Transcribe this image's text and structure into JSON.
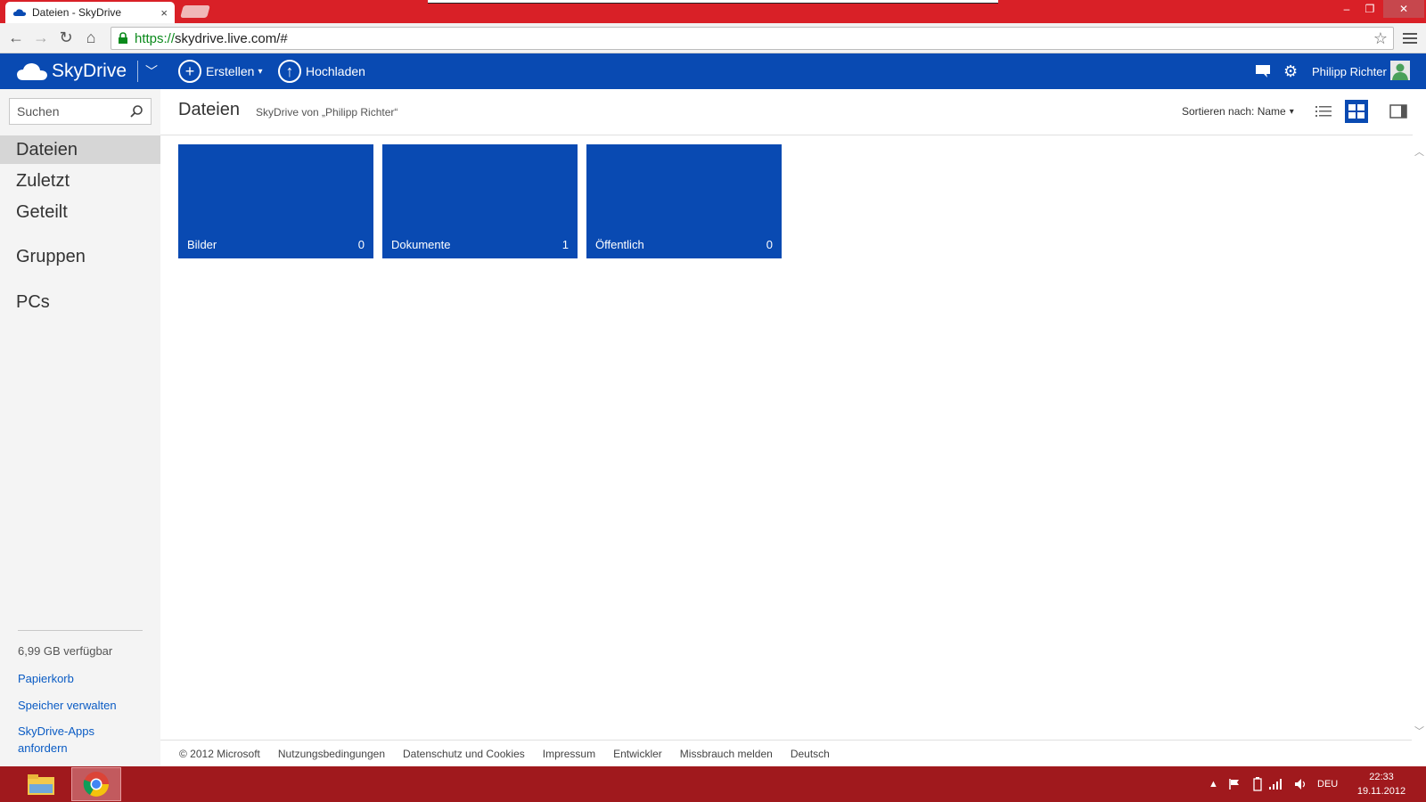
{
  "browser": {
    "tab_title": "Dateien - SkyDrive",
    "tab_close": "×",
    "url_scheme": "https://",
    "url_host": "skydrive.live.com/#",
    "window_controls": {
      "minimize": "–",
      "maximize": "❐",
      "close": "✕"
    },
    "nav": {
      "back": "←",
      "forward": "→",
      "reload": "↻",
      "home": "⌂"
    },
    "star": "☆"
  },
  "header": {
    "brand": "SkyDrive",
    "create_label": "Erstellen",
    "upload_label": "Hochladen",
    "user_name": "Philipp Richter",
    "bg_color": "#094ab2"
  },
  "sidebar": {
    "search_placeholder": "Suchen",
    "nav_items": [
      "Dateien",
      "Zuletzt",
      "Geteilt"
    ],
    "groups_label": "Gruppen",
    "pcs_label": "PCs",
    "storage_info": "6,99 GB verfügbar",
    "links": [
      "Papierkorb",
      "Speicher verwalten",
      "SkyDrive-Apps anfordern"
    ]
  },
  "content": {
    "title": "Dateien",
    "subtitle": "SkyDrive von „Philipp Richter“",
    "sort_label": "Sortieren nach: Name",
    "tiles": [
      {
        "name": "Bilder",
        "count": "0"
      },
      {
        "name": "Dokumente",
        "count": "1"
      },
      {
        "name": "Öffentlich",
        "count": "0"
      }
    ]
  },
  "footer": {
    "items": [
      "© 2012 Microsoft",
      "Nutzungsbedingungen",
      "Datenschutz und Cookies",
      "Impressum",
      "Entwickler",
      "Missbrauch melden",
      "Deutsch"
    ]
  },
  "taskbar": {
    "language": "DEU",
    "time": "22:33",
    "date": "19.11.2012"
  }
}
